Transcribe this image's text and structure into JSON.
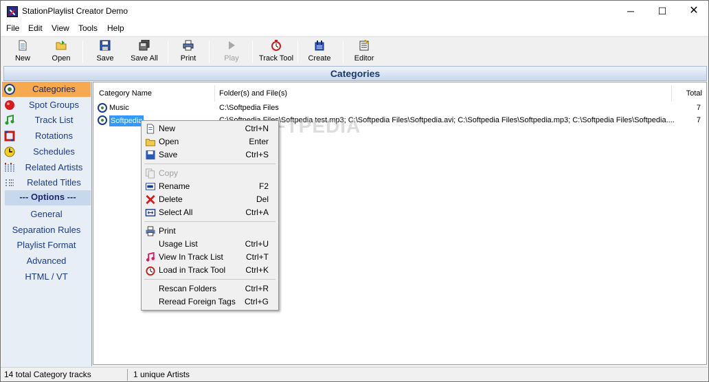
{
  "window": {
    "title": "StationPlaylist Creator Demo"
  },
  "menu": {
    "items": [
      "File",
      "Edit",
      "View",
      "Tools",
      "Help"
    ]
  },
  "toolbar": {
    "new": "New",
    "open": "Open",
    "save": "Save",
    "save_all": "Save All",
    "print": "Print",
    "play": "Play",
    "track_tool": "Track Tool",
    "create": "Create",
    "editor": "Editor"
  },
  "banner": {
    "title": "Categories"
  },
  "sidebar": {
    "items": [
      "Categories",
      "Spot Groups",
      "Track List",
      "Rotations",
      "Schedules",
      "Related Artists",
      "Related Titles"
    ],
    "options_header": "--- Options ---",
    "options": [
      "General",
      "Separation Rules",
      "Playlist Format",
      "Advanced",
      "HTML / VT"
    ]
  },
  "list": {
    "columns": [
      "Category Name",
      "Folder(s) and File(s)",
      "Total"
    ],
    "rows": [
      {
        "name": "Music",
        "files": "C:\\Softpedia Files",
        "total": "7"
      },
      {
        "name": "Softpedia",
        "files": "C:\\Softpedia Files\\Softpedia test.mp3; C:\\Softpedia Files\\Softpedia.avi; C:\\Softpedia Files\\Softpedia.mp3; C:\\Softpedia Files\\Softpedia....",
        "total": "7"
      }
    ],
    "watermark": "SOFTPEDIA"
  },
  "context_menu": {
    "items": [
      {
        "label": "New",
        "key": "Ctrl+N"
      },
      {
        "label": "Open",
        "key": "Enter"
      },
      {
        "label": "Save",
        "key": "Ctrl+S"
      },
      {
        "label": "Copy",
        "key": ""
      },
      {
        "label": "Rename",
        "key": "F2"
      },
      {
        "label": "Delete",
        "key": "Del"
      },
      {
        "label": "Select All",
        "key": "Ctrl+A"
      },
      {
        "label": "Print",
        "key": ""
      },
      {
        "label": "Usage List",
        "key": "Ctrl+U"
      },
      {
        "label": "View In Track List",
        "key": "Ctrl+T"
      },
      {
        "label": "Load in Track Tool",
        "key": "Ctrl+K"
      },
      {
        "label": "Rescan Folders",
        "key": "Ctrl+R"
      },
      {
        "label": "Reread Foreign Tags",
        "key": "Ctrl+G"
      }
    ]
  },
  "status": {
    "tracks": "14 total Category tracks",
    "artists": "1 unique Artists"
  },
  "colors": {
    "active_sidebar": "#f7a94f",
    "selection": "#3399ff",
    "banner_text": "#1a3a6c"
  }
}
